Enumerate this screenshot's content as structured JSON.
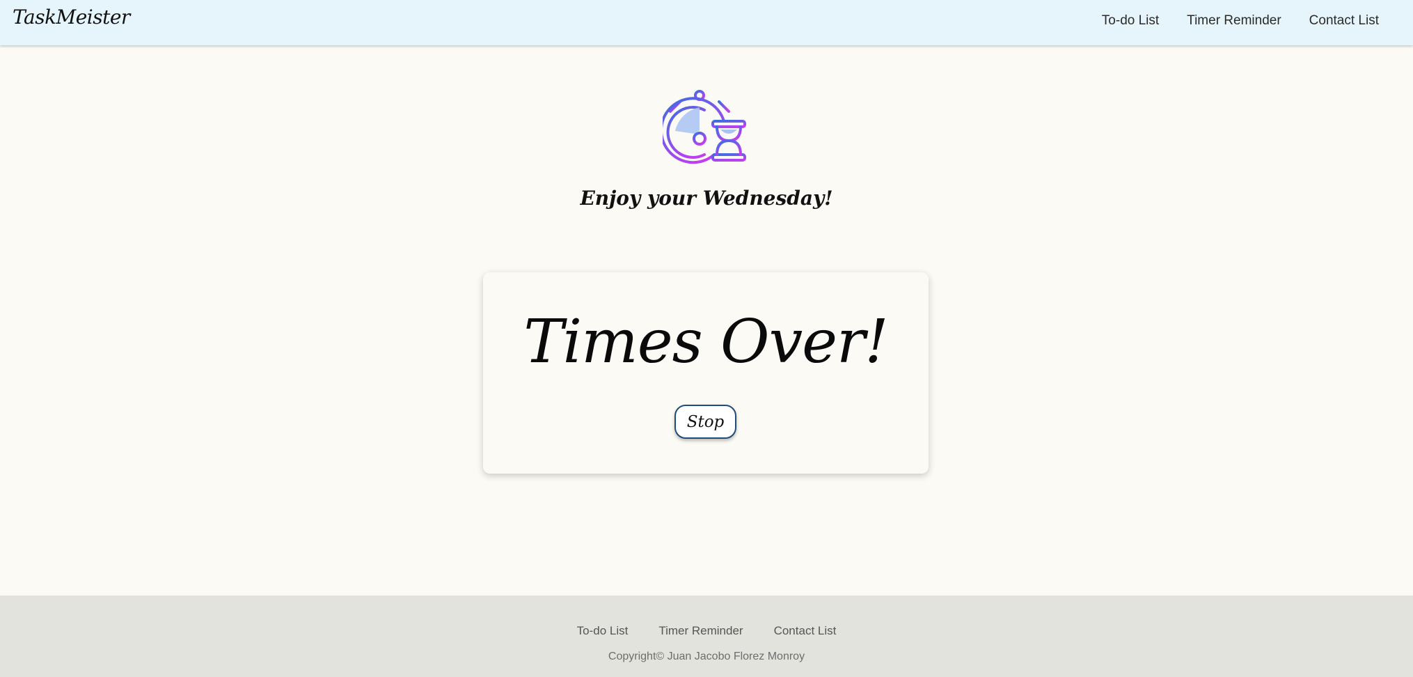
{
  "header": {
    "brand": "TaskMeister",
    "nav": [
      {
        "label": "To-do List"
      },
      {
        "label": "Timer Reminder"
      },
      {
        "label": "Contact List"
      }
    ]
  },
  "main": {
    "logo_icon": "stopwatch-hourglass-icon",
    "greeting": "Enjoy your Wednesday!",
    "card": {
      "title": "Times Over!",
      "stop_label": "Stop"
    }
  },
  "footer": {
    "links": [
      {
        "label": "To-do List"
      },
      {
        "label": "Timer Reminder"
      },
      {
        "label": "Contact List"
      }
    ],
    "copyright": "Copyright© Juan Jacobo Florez Monroy"
  },
  "colors": {
    "navbar_bg": "#e6f5fb",
    "page_bg": "#fbfaf4",
    "footer_bg": "#e3e3de",
    "button_border": "#204c7c",
    "icon_gradient_start": "#3a6fe0",
    "icon_gradient_end": "#c03ef0"
  }
}
